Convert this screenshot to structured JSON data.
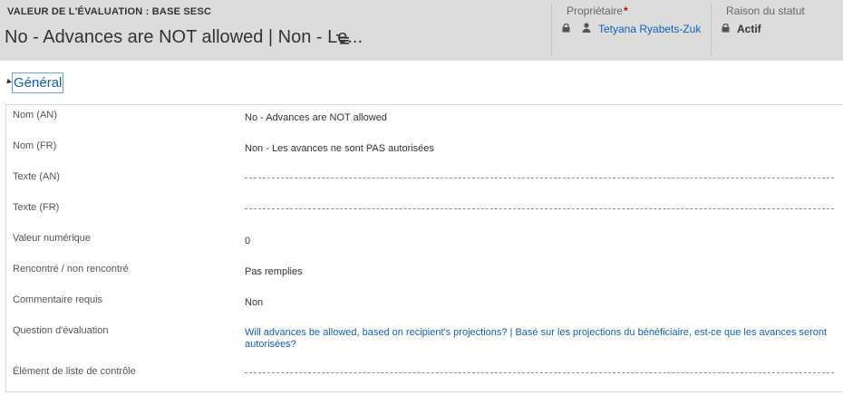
{
  "header": {
    "entity_type": "VALEUR DE L'ÉVALUATION : BASE SESC",
    "record_title": "No - Advances are NOT allowed | Non - Le...",
    "owner_label": "Propriétaire",
    "required_marker": "*",
    "owner_name": "Tetyana Ryabets-Zuk",
    "status_label": "Raison du statut",
    "status_value": "Actif"
  },
  "section": {
    "title": "Général",
    "fields": [
      {
        "label": "Nom (AN)",
        "value": "No - Advances are NOT allowed"
      },
      {
        "label": "Nom (FR)",
        "value": "Non - Les avances ne sont PAS autorisées"
      },
      {
        "label": "Texte (AN)",
        "value": ""
      },
      {
        "label": "Texte (FR)",
        "value": ""
      },
      {
        "label": "Valeur numérique",
        "value": "0"
      },
      {
        "label": "Rencontré / non rencontré",
        "value": "Pas remplies"
      },
      {
        "label": "Commentaire requis",
        "value": "Non"
      },
      {
        "label": "Question d'évaluation",
        "value": "Will advances be allowed, based on recipient's projections? | Basé sur les projections du bénéficiaire, est-ce que les avances seront autorisées?"
      },
      {
        "label": "Élément de liste de contrôle",
        "value": ""
      }
    ]
  },
  "icons": {
    "menu": "hamburger-menu-icon",
    "lock": "lock-icon",
    "user": "user-icon",
    "collapse": "collapse-triangle-icon"
  },
  "colors": {
    "header_bg": "#dcdcdc",
    "link": "#1160b7",
    "required": "#cc0000"
  }
}
